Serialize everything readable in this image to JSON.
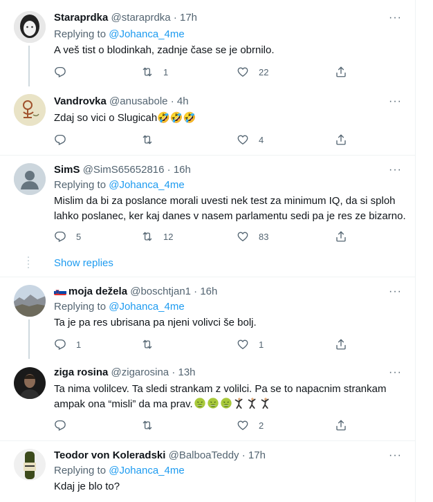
{
  "tweets": [
    {
      "name": "Staraprdka",
      "handle": "@staraprdka",
      "time": "17h",
      "replying_prefix": "Replying to",
      "replying_to": "@Johanca_4me",
      "text": "A veš tist o blodinkah, zadnje čase se je obrnilo.",
      "replies": "",
      "retweets": "1",
      "likes": "22"
    },
    {
      "name": "Vandrovka",
      "handle": "@anusabole",
      "time": "4h",
      "text": "Zdaj so vici o Slugicah🤣🤣🤣",
      "replies": "",
      "retweets": "",
      "likes": "4"
    },
    {
      "name": "SimS",
      "handle": "@SimS65652816",
      "time": "16h",
      "replying_prefix": "Replying to",
      "replying_to": "@Johanca_4me",
      "text_line1": "Mislim da bi za poslance morali uvesti nek test za minimum IQ, da si sploh",
      "text_line2": "lahko poslanec, ker kaj danes v nasem parlamentu sedi pa je res ze bizarno.",
      "replies": "5",
      "retweets": "12",
      "likes": "83"
    },
    {
      "name": "moja dežela",
      "handle": "@boschtjan1",
      "time": "16h",
      "replying_prefix": "Replying to",
      "replying_to": "@Johanca_4me",
      "text": "Ta je pa res ubrisana pa njeni volivci še bolj.",
      "replies": "1",
      "retweets": "",
      "likes": "1"
    },
    {
      "name": "ziga rosina",
      "handle": "@zigarosina",
      "time": "13h",
      "text_line1": "Ta nima volilcev. Ta sledi strankam z volilci. Pa se to napacnim strankam",
      "text_line2": "ampak ona “misli” da ma prav.",
      "replies": "",
      "retweets": "",
      "likes": "2"
    },
    {
      "name": "Teodor von Koleradski",
      "handle": "@BalboaTeddy",
      "time": "17h",
      "replying_prefix": "Replying to",
      "replying_to": "@Johanca_4me",
      "text": "Kdaj je blo to?"
    }
  ],
  "show_replies": "Show replies",
  "separator": "·",
  "more_glyph": "···",
  "icons": [
    "reply-icon",
    "retweet-icon",
    "like-icon",
    "share-icon",
    "more-icon",
    "flag-slovenia-icon",
    "rofl-emoji",
    "nauseated-emoji",
    "dancer-emoji"
  ],
  "colors": {
    "link": "#1d9bf0",
    "secondary": "#536471",
    "divider": "#eff3f4",
    "thread": "#cfd9de"
  }
}
